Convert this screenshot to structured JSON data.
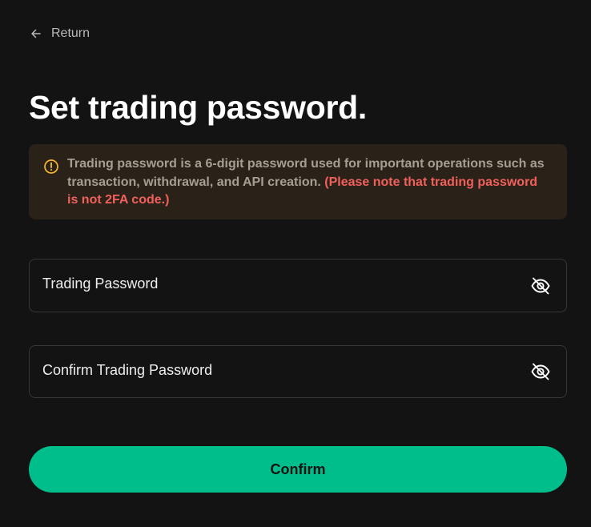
{
  "nav": {
    "return_label": "Return",
    "return_icon": "arrow-left-icon"
  },
  "title": "Set trading password.",
  "notice": {
    "icon": "warning-circle-icon",
    "icon_color": "#f5b82a",
    "text": "Trading password is a 6-digit password used for important operations such as transaction, withdrawal, and API creation. ",
    "warning_text": "(Please note that trading password is not 2FA code.)",
    "background": "#2a2219",
    "warning_color": "#f2605c"
  },
  "fields": {
    "trading_password": {
      "placeholder": "Trading Password",
      "value": "",
      "toggle_icon": "eye-off-icon"
    },
    "confirm_password": {
      "placeholder": "Confirm Trading Password",
      "value": "",
      "toggle_icon": "eye-off-icon"
    }
  },
  "confirm_button": {
    "label": "Confirm",
    "color": "#00bd8c"
  }
}
